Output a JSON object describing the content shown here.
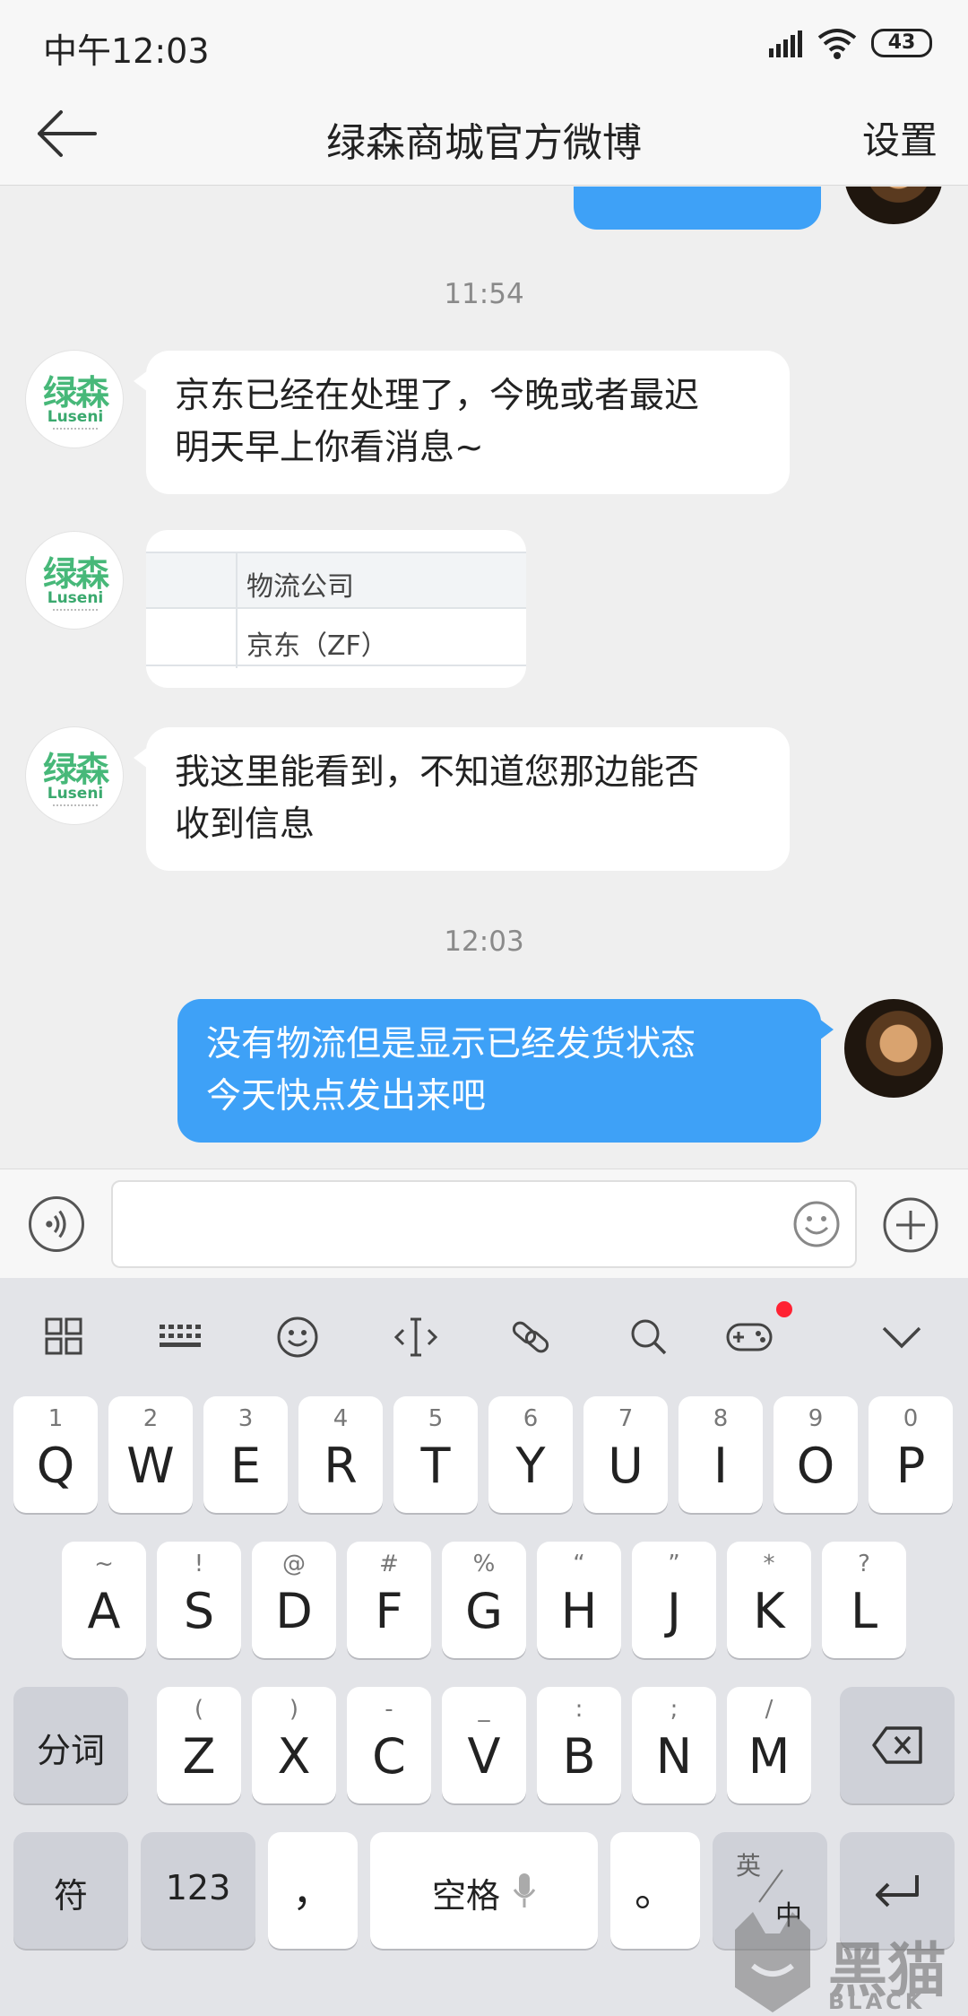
{
  "status_bar": {
    "time": "中午12:03",
    "battery": "43"
  },
  "header": {
    "title": "绿森商城官方微博",
    "settings_label": "设置"
  },
  "brand_avatar": {
    "zh": "绿森",
    "en": "Luseni"
  },
  "chat": {
    "timestamps": [
      "11:54",
      "12:03"
    ],
    "messages": [
      {
        "from": "them",
        "lines": [
          "京东已经在处理了，今晚或者最迟",
          "明天早上你看消息~"
        ]
      },
      {
        "from": "them",
        "type": "image",
        "table": {
          "header": "物流公司",
          "value": "京东（ZF）"
        }
      },
      {
        "from": "them",
        "lines": [
          "我这里能看到，不知道您那边能否",
          "收到信息"
        ]
      },
      {
        "from": "me",
        "lines": [
          "没有物流但是显示已经发货状态",
          "今天快点发出来吧"
        ]
      }
    ]
  },
  "input": {
    "value": "",
    "placeholder": ""
  },
  "keyboard": {
    "toolbar": [
      "grid-icon",
      "keyboard-icon",
      "emoji-icon",
      "cursor-icon",
      "clip-icon",
      "search-icon",
      "gamepad-icon",
      "collapse-icon"
    ],
    "row1": [
      {
        "k": "Q",
        "s": "1"
      },
      {
        "k": "W",
        "s": "2"
      },
      {
        "k": "E",
        "s": "3"
      },
      {
        "k": "R",
        "s": "4"
      },
      {
        "k": "T",
        "s": "5"
      },
      {
        "k": "Y",
        "s": "6"
      },
      {
        "k": "U",
        "s": "7"
      },
      {
        "k": "I",
        "s": "8"
      },
      {
        "k": "O",
        "s": "9"
      },
      {
        "k": "P",
        "s": "0"
      }
    ],
    "row2": [
      {
        "k": "A",
        "s": "~"
      },
      {
        "k": "S",
        "s": "!"
      },
      {
        "k": "D",
        "s": "@"
      },
      {
        "k": "F",
        "s": "#"
      },
      {
        "k": "G",
        "s": "%"
      },
      {
        "k": "H",
        "s": "“"
      },
      {
        "k": "J",
        "s": "”"
      },
      {
        "k": "K",
        "s": "*"
      },
      {
        "k": "L",
        "s": "?"
      }
    ],
    "row3": [
      {
        "k": "Z",
        "s": "("
      },
      {
        "k": "X",
        "s": ")"
      },
      {
        "k": "C",
        "s": "-"
      },
      {
        "k": "V",
        "s": "_"
      },
      {
        "k": "B",
        "s": ":"
      },
      {
        "k": "N",
        "s": ";"
      },
      {
        "k": "M",
        "s": "/"
      }
    ],
    "fenci": "分词",
    "fu": "符",
    "num": "123",
    "comma": "，",
    "space": "空格",
    "period": "。",
    "lang_top": "英",
    "lang_bottom": "中"
  },
  "watermark": {
    "cn": "黑猫",
    "en": "BLACK CAT"
  }
}
